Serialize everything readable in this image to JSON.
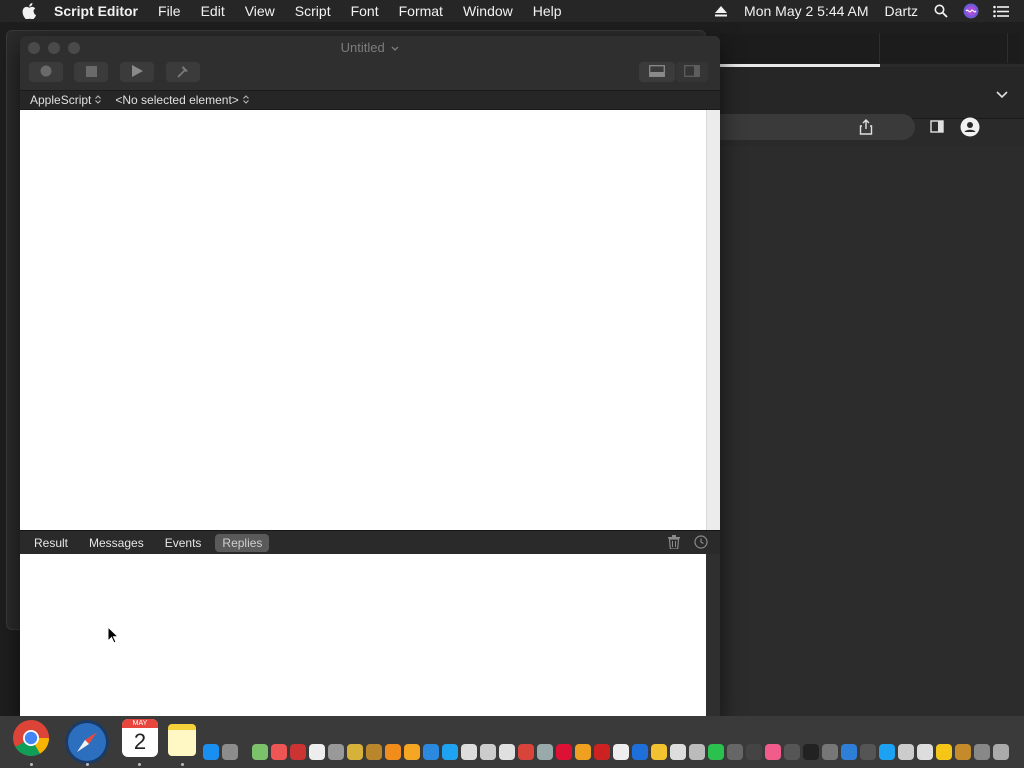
{
  "menubar": {
    "app_name": "Script Editor",
    "items": [
      "File",
      "Edit",
      "View",
      "Script",
      "Font",
      "Format",
      "Window",
      "Help"
    ],
    "datetime": "Mon May 2  5:44 AM",
    "user": "Dartz"
  },
  "window": {
    "title": "Untitled"
  },
  "navigation": {
    "language": "AppleScript",
    "element": "<No selected element>"
  },
  "result_tabs": [
    {
      "label": "Result",
      "active": false
    },
    {
      "label": "Messages",
      "active": false
    },
    {
      "label": "Events",
      "active": false
    },
    {
      "label": "Replies",
      "active": true
    }
  ],
  "dock": {
    "calendar_month": "MAY",
    "calendar_day": "2"
  },
  "colors": {
    "menubar": "#262626",
    "window_bg": "#2d2d2d",
    "editor_bg": "#ffffff",
    "active_tab": "#5a5a5a",
    "dock": "#3a3a3a"
  }
}
